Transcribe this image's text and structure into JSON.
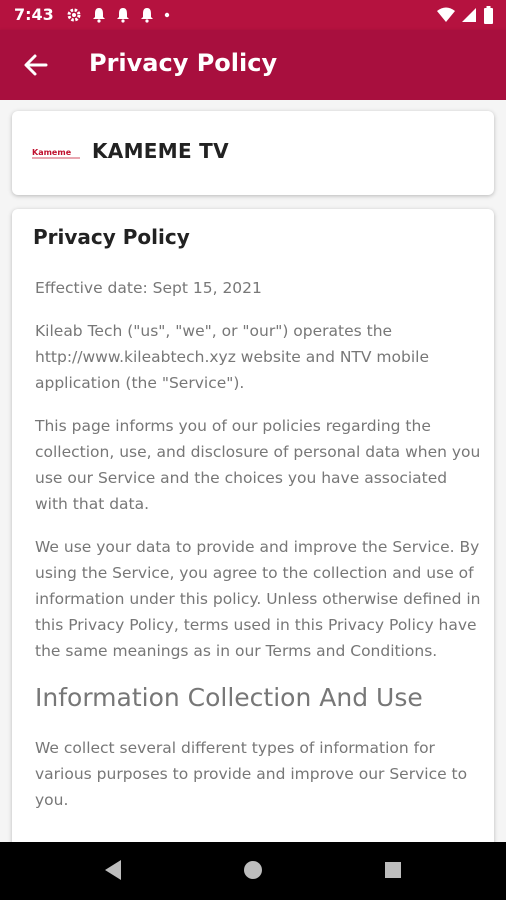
{
  "status_bar": {
    "time": "7:43",
    "icons": [
      "gear-icon",
      "bell-icon",
      "bell-icon",
      "bell-icon",
      "dot-icon"
    ],
    "right_icons": [
      "wifi-icon",
      "signal-icon",
      "battery-icon"
    ]
  },
  "app_bar": {
    "title": "Privacy Policy",
    "back_icon": "arrow-left-icon",
    "color": "#a80f3e"
  },
  "brand": {
    "name": "KAMEME TV",
    "logo_text": "Kameme"
  },
  "policy": {
    "title": "Privacy Policy",
    "paragraphs": [
      "Effective date: Sept 15, 2021",
      "Kileab Tech (\"us\", \"we\", or \"our\") operates the http://www.kileabtech.xyz website and  NTV mobile application (the \"Service\").",
      "This page informs you of our policies regarding the collection, use, and disclosure of personal data when you use our Service and the choices you have associated with that data.",
      "We use your data to provide and improve the Service. By using the Service, you agree to the collection and use of information under this policy. Unless otherwise defined in this Privacy Policy, terms used in this Privacy Policy have the same meanings as in our Terms and Conditions."
    ],
    "section_heading": "Information Collection And Use",
    "section_paragraph": "We collect several different types of information for various purposes to provide and improve our Service to you."
  },
  "nav_bar": {
    "icons": [
      "back-triangle-icon",
      "home-circle-icon",
      "recents-square-icon"
    ]
  }
}
